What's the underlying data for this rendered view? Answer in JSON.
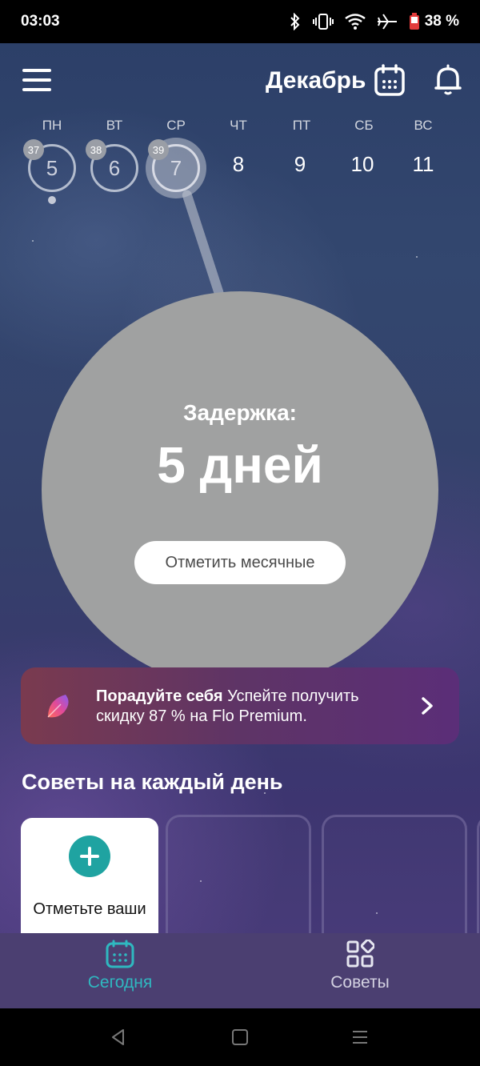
{
  "status_bar": {
    "time": "03:03",
    "battery": "38 %"
  },
  "header": {
    "month": "Декабрь"
  },
  "week": [
    {
      "weekday": "ПН",
      "day": "5",
      "badge": "37",
      "state": "past"
    },
    {
      "weekday": "ВТ",
      "day": "6",
      "badge": "38",
      "state": "past"
    },
    {
      "weekday": "СР",
      "day": "7",
      "badge": "39",
      "state": "today"
    },
    {
      "weekday": "ЧТ",
      "day": "8"
    },
    {
      "weekday": "ПТ",
      "day": "9"
    },
    {
      "weekday": "СБ",
      "day": "10"
    },
    {
      "weekday": "ВС",
      "day": "11"
    }
  ],
  "cycle": {
    "label": "Задержка:",
    "value": "5 дней",
    "button": "Отметить месячные"
  },
  "promo": {
    "bold": "Порадуйте себя",
    "text": " Успейте получить скидку 87 % на Flo Premium."
  },
  "tips": {
    "title": "Советы на каждый день",
    "card_label": "Отметьте ваши"
  },
  "tabs": [
    {
      "label": "Сегодня",
      "active": true
    },
    {
      "label": "Советы",
      "active": false
    }
  ],
  "colors": {
    "accent": "#2fb8c0",
    "tab_bar": "#4b3f71",
    "circle": "#a0a1a1",
    "plus": "#1fa3a1"
  }
}
